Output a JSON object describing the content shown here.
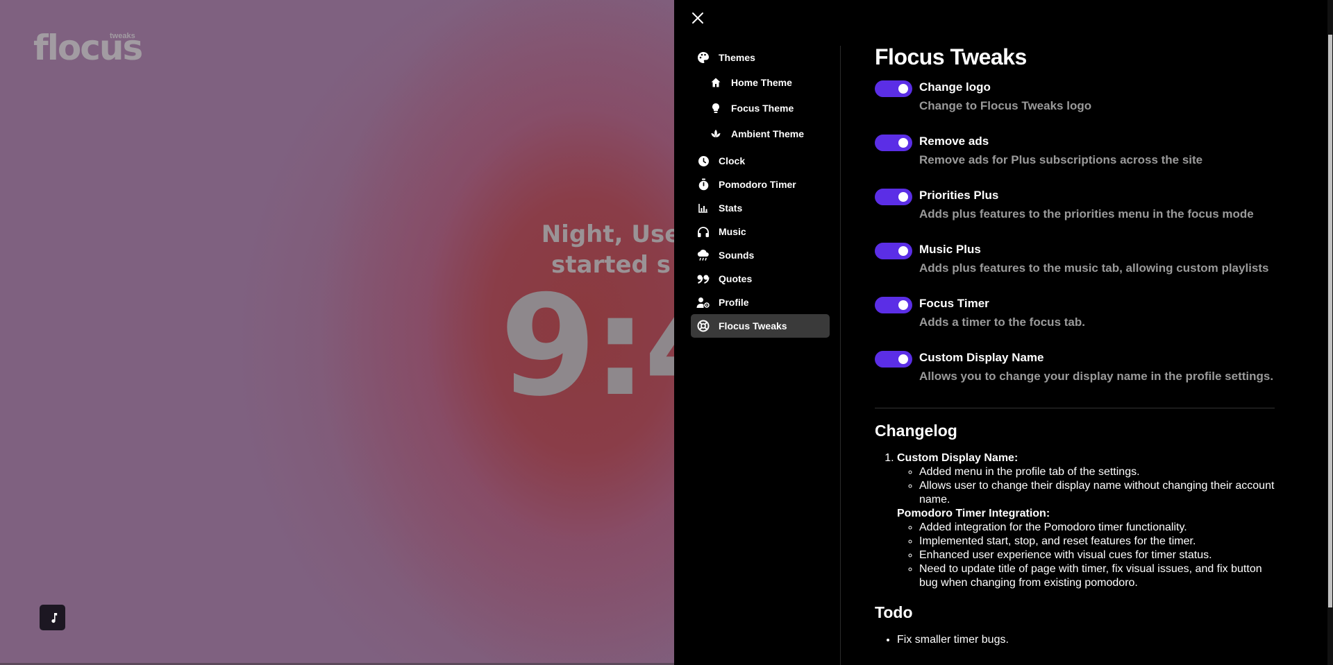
{
  "background": {
    "logo_text": "flocus",
    "logo_badge": "tweaks",
    "greeting_line1": "Night, Use",
    "greeting_line2": "started s",
    "clock": "9:4",
    "music_button_icon": "music-note-icon"
  },
  "panel": {
    "close_icon": "close-icon",
    "sidebar": {
      "themes": "Themes",
      "home_theme": "Home Theme",
      "focus_theme": "Focus Theme",
      "ambient_theme": "Ambient Theme",
      "clock": "Clock",
      "pomodoro_timer": "Pomodoro Timer",
      "stats": "Stats",
      "music": "Music",
      "sounds": "Sounds",
      "quotes": "Quotes",
      "profile": "Profile",
      "flocus_tweaks": "Flocus Tweaks"
    },
    "title": "Flocus Tweaks",
    "tweaks": [
      {
        "title": "Change logo",
        "desc": "Change to Flocus Tweaks logo",
        "enabled": true
      },
      {
        "title": "Remove ads",
        "desc": "Remove ads for Plus subscriptions across the site",
        "enabled": true
      },
      {
        "title": "Priorities Plus",
        "desc": "Adds plus features to the priorities menu in the focus mode",
        "enabled": true
      },
      {
        "title": "Music Plus",
        "desc": "Adds plus features to the music tab, allowing custom playlists",
        "enabled": true
      },
      {
        "title": "Focus Timer",
        "desc": "Adds a timer to the focus tab.",
        "enabled": true
      },
      {
        "title": "Custom Display Name",
        "desc": "Allows you to change your display name in the profile settings.",
        "enabled": true
      }
    ],
    "changelog_title": "Changelog",
    "changelog": {
      "section1_title": "Custom Display Name:",
      "section1_items": [
        "Added menu in the profile tab of the settings.",
        "Allows user to change their display name without changing their account name."
      ],
      "section2_title": "Pomodoro Timer Integration:",
      "section2_items": [
        "Added integration for the Pomodoro timer functionality.",
        "Implemented start, stop, and reset features for the timer.",
        "Enhanced user experience with visual cues for timer status.",
        "Need to update title of page with timer, fix visual issues, and fix button bug when changing from existing pomodoro."
      ]
    },
    "todo_title": "Todo",
    "todo_items": [
      "Fix smaller timer bugs."
    ]
  },
  "colors": {
    "toggle_on": "#5b2ee6",
    "panel_bg": "#000000",
    "active_nav_bg": "#3a3a3a",
    "muted_text": "#9a9a9a"
  }
}
